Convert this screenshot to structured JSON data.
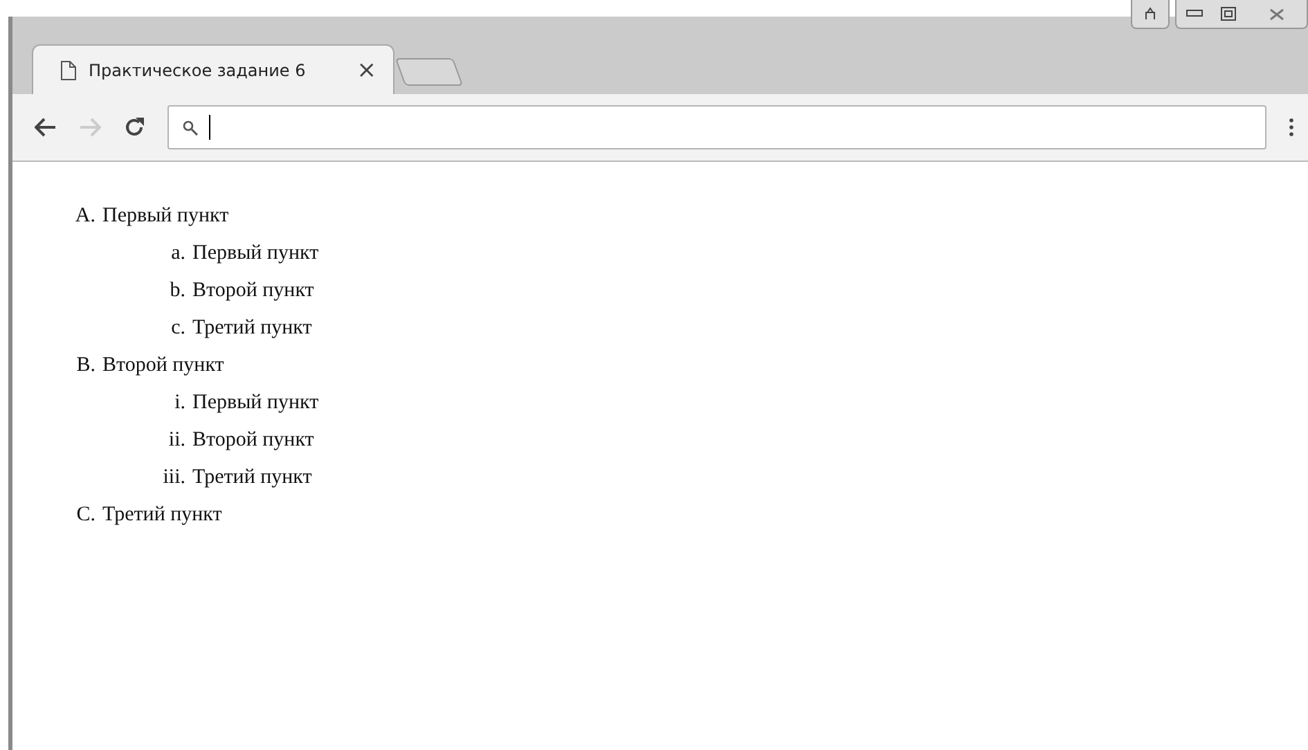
{
  "tabs": [
    {
      "title": "Практическое задание 6",
      "close": "×"
    }
  ],
  "list": [
    {
      "marker": "A.",
      "text": "Первый пункт",
      "children": [
        {
          "marker": "a.",
          "text": "Первый пункт"
        },
        {
          "marker": "b.",
          "text": "Второй пункт"
        },
        {
          "marker": "c.",
          "text": "Третий пункт"
        }
      ]
    },
    {
      "marker": "B.",
      "text": "Второй пункт",
      "children": [
        {
          "marker": "i.",
          "text": "Первый пункт"
        },
        {
          "marker": "ii.",
          "text": "Второй пункт"
        },
        {
          "marker": "iii.",
          "text": "Третий пункт"
        }
      ]
    },
    {
      "marker": "C.",
      "text": "Третий пункт"
    }
  ]
}
